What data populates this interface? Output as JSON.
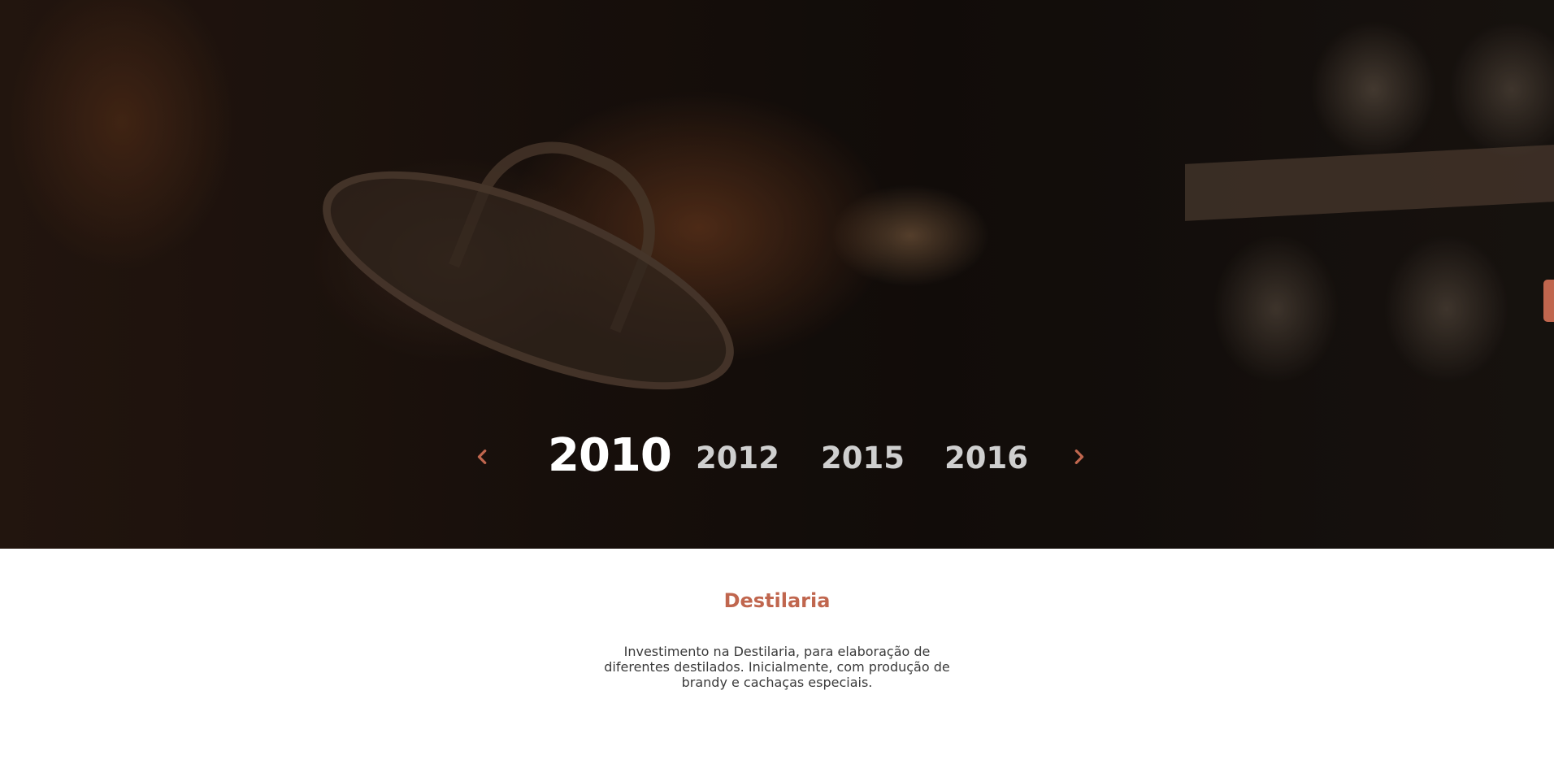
{
  "hero": {
    "background_description_icon": "distillery-background-image"
  },
  "timeline": {
    "prev_icon": "chevron-left-icon",
    "next_icon": "chevron-right-icon",
    "years": [
      "2010",
      "2012",
      "2015",
      "2016"
    ],
    "active_year": "2010"
  },
  "content": {
    "title": "Destilaria",
    "text": "Investimento na Destilaria, para elaboração de diferentes  destilados. Inicialmente, com produção de brandy e cachaças especiais."
  },
  "colors": {
    "accent": "#c0664e",
    "active_year": "#ffffff",
    "inactive_year": "#cfcfcf",
    "body_text": "#3a3a3a"
  }
}
